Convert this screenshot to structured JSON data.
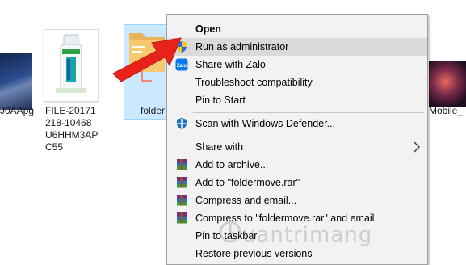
{
  "desktop": {
    "files": [
      {
        "id": "left-image",
        "label": "J0AApg"
      },
      {
        "id": "bottle-image",
        "label": "FILE-20171218-10468U6HHM3APC55"
      },
      {
        "id": "folder",
        "label": "folder"
      },
      {
        "id": "right-image",
        "label": "Mobile_"
      }
    ]
  },
  "context_menu": {
    "items": [
      {
        "label": "Open",
        "bold": true,
        "icon": null
      },
      {
        "label": "Run as administrator",
        "icon": "uac-shield-icon",
        "highlighted": true
      },
      {
        "label": "Share with Zalo",
        "icon": "zalo-icon"
      },
      {
        "label": "Troubleshoot compatibility",
        "icon": null
      },
      {
        "label": "Pin to Start",
        "icon": null
      },
      {
        "label": "Scan with Windows Defender...",
        "icon": "windows-defender-icon"
      },
      {
        "label": "Share with",
        "icon": null,
        "submenu": true
      },
      {
        "label": "Add to archive...",
        "icon": "winrar-icon"
      },
      {
        "label": "Add to \"foldermove.rar\"",
        "icon": "winrar-icon"
      },
      {
        "label": "Compress and email...",
        "icon": "winrar-icon"
      },
      {
        "label": "Compress to \"foldermove.rar\" and email",
        "icon": "winrar-icon"
      },
      {
        "label": "Pin to taskbar",
        "icon": null
      },
      {
        "label": "Restore previous versions",
        "icon": null
      }
    ]
  },
  "watermark": {
    "text": "uantrimang"
  },
  "colors": {
    "menu_bg": "#f2f2f2",
    "menu_highlight": "#dadada",
    "selection_fill": "#cce8ff",
    "arrow_red": "#e8221b"
  }
}
